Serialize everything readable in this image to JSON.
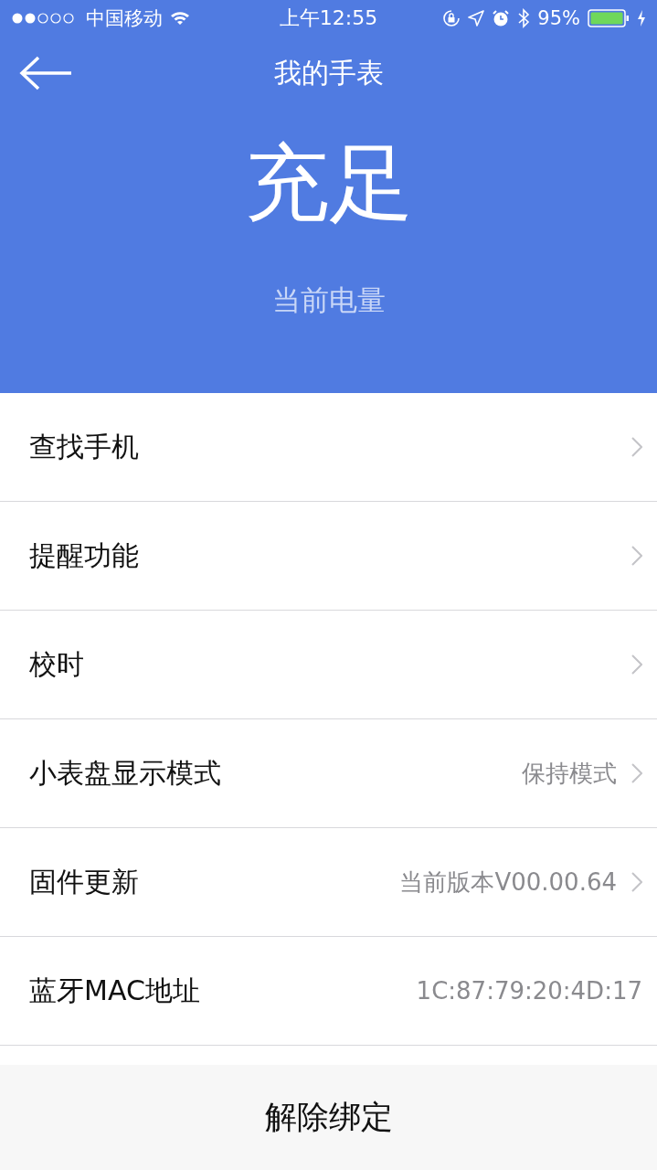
{
  "status_bar": {
    "carrier": "中国移动",
    "time": "上午12:55",
    "battery_percent": "95%"
  },
  "header": {
    "title": "我的手表",
    "battery_status": "充足",
    "battery_caption": "当前电量"
  },
  "rows": [
    {
      "label": "查找手机",
      "kind": "link"
    },
    {
      "label": "提醒功能",
      "kind": "link"
    },
    {
      "label": "校时",
      "kind": "link"
    },
    {
      "label": "小表盘显示模式",
      "value": "保持模式",
      "kind": "link"
    },
    {
      "label": "固件更新",
      "value": "当前版本V00.00.64",
      "kind": "link"
    },
    {
      "label": "蓝牙MAC地址",
      "value": "1C:87:79:20:4D:17",
      "kind": "info"
    }
  ],
  "unbind_button": "解除绑定"
}
